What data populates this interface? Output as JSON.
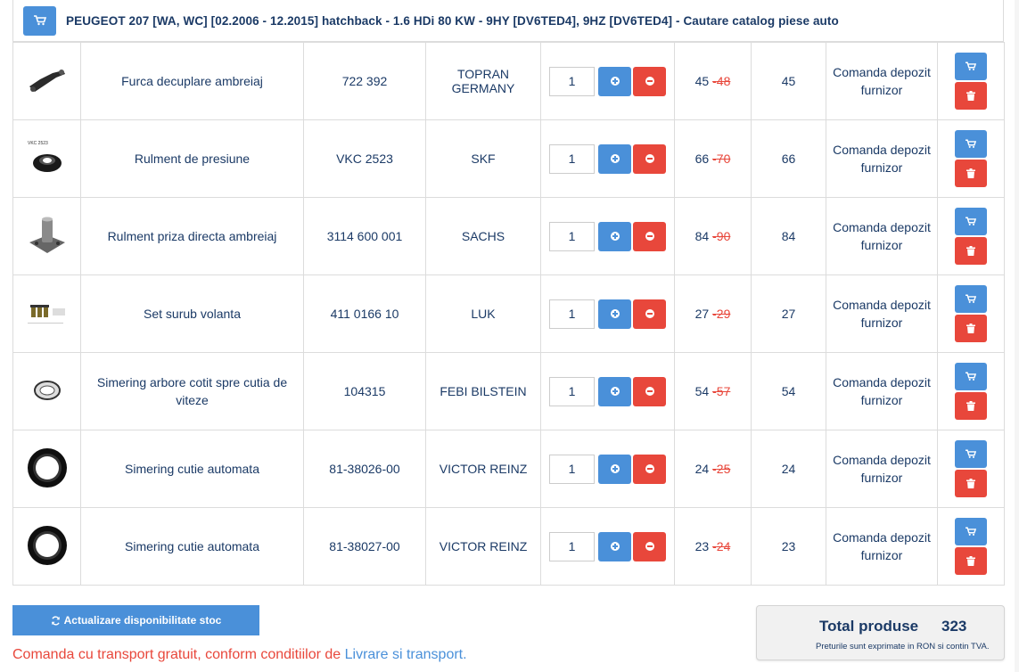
{
  "header": {
    "title": "PEUGEOT 207 [WA, WC] [02.2006 - 12.2015] hatchback - 1.6 HDi 80 KW - 9HY [DV6TED4], 9HZ [DV6TED4] - Cautare catalog piese auto",
    "icon": "shopping-cart-icon"
  },
  "rows": [
    {
      "image": "clutch-fork-image",
      "name": "Furca decuplare ambreiaj",
      "code": "722 392",
      "brand": "TOPRAN GERMANY",
      "qty": "1",
      "price": "45",
      "old_price": "48",
      "total": "45",
      "status": "Comanda depozit furnizor"
    },
    {
      "image": "release-bearing-image",
      "name": "Rulment de presiune",
      "code": "VKC 2523",
      "brand": "SKF",
      "qty": "1",
      "price": "66",
      "old_price": "70",
      "total": "66",
      "status": "Comanda depozit furnizor"
    },
    {
      "image": "guide-sleeve-image",
      "name": "Rulment priza directa ambreiaj",
      "code": "3114 600 001",
      "brand": "SACHS",
      "qty": "1",
      "price": "84",
      "old_price": "90",
      "total": "84",
      "status": "Comanda depozit furnizor"
    },
    {
      "image": "bolt-set-image",
      "name": "Set surub volanta",
      "code": "411 0166 10",
      "brand": "LUK",
      "qty": "1",
      "price": "27",
      "old_price": "29",
      "total": "27",
      "status": "Comanda depozit furnizor"
    },
    {
      "image": "shaft-seal-small-image",
      "name": "Simering arbore cotit spre cutia de viteze",
      "code": "104315",
      "brand": "FEBI BILSTEIN",
      "qty": "1",
      "price": "54",
      "old_price": "57",
      "total": "54",
      "status": "Comanda depozit furnizor"
    },
    {
      "image": "shaft-seal-image",
      "name": "Simering cutie automata",
      "code": "81-38026-00",
      "brand": "VICTOR REINZ",
      "qty": "1",
      "price": "24",
      "old_price": "25",
      "total": "24",
      "status": "Comanda depozit furnizor"
    },
    {
      "image": "shaft-seal-image",
      "name": "Simering cutie automata",
      "code": "81-38027-00",
      "brand": "VICTOR REINZ",
      "qty": "1",
      "price": "23",
      "old_price": "24",
      "total": "23",
      "status": "Comanda depozit furnizor"
    }
  ],
  "update_button": {
    "label": "Actualizare disponibilitate stoc",
    "icon": "refresh-icon"
  },
  "shipping": {
    "text": "Comanda cu transport gratuit, conform conditiilor de ",
    "link": "Livrare si transport",
    "suffix": "."
  },
  "totals": {
    "label": "Total produse",
    "value": "323",
    "note": "Preturile sunt exprimate in RON si contin TVA."
  },
  "colors": {
    "primary": "#4a90d9",
    "danger": "#e8473b",
    "text": "#1b3a66",
    "image_labels": [
      "VKC 2523"
    ]
  }
}
